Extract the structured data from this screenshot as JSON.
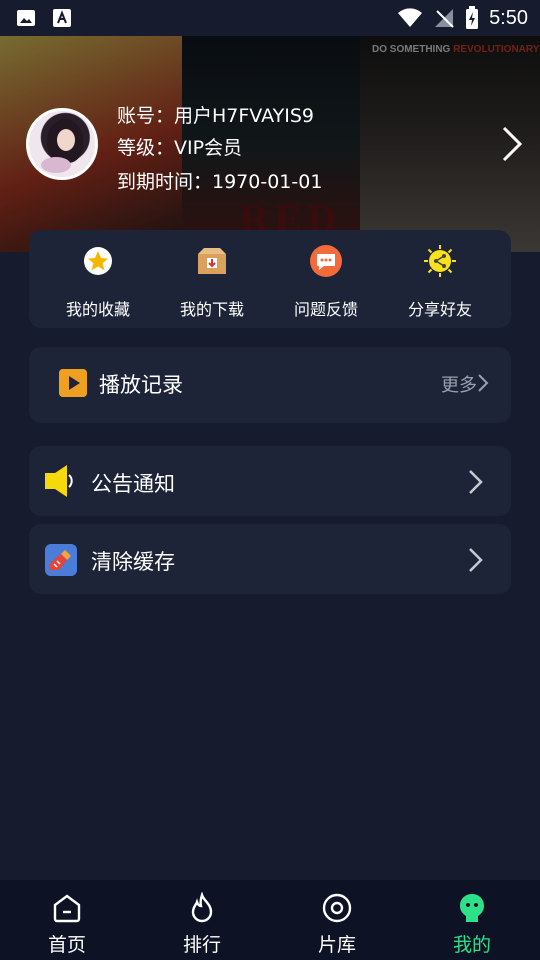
{
  "status_bar": {
    "time": "5:50"
  },
  "hero": {
    "poster_title_1": "RED",
    "poster_title_2_a": "DO SOMETHING ",
    "poster_title_2_b": "REVOLUTIONARY",
    "account_line": "账号：用户H7FVAYIS9",
    "level_line": "等级：VIP会员",
    "expire_line": "到期时间：1970-01-01"
  },
  "quick_actions": [
    {
      "label": "我的收藏",
      "icon": "star-icon"
    },
    {
      "label": "我的下载",
      "icon": "download-box-icon"
    },
    {
      "label": "问题反馈",
      "icon": "feedback-chat-icon"
    },
    {
      "label": "分享好友",
      "icon": "share-icon"
    }
  ],
  "history": {
    "label": "播放记录",
    "more": "更多"
  },
  "menu": {
    "notice": "公告通知",
    "cache": "清除缓存"
  },
  "tabs": [
    {
      "label": "首页",
      "icon": "home-icon"
    },
    {
      "label": "排行",
      "icon": "fire-icon"
    },
    {
      "label": "片库",
      "icon": "library-disc-icon"
    },
    {
      "label": "我的",
      "icon": "profile-face-icon",
      "active": true
    }
  ],
  "colors": {
    "accent": "#2de08a",
    "background": "#161b2e",
    "card": "#1e2438",
    "tabbar": "#0d1224"
  }
}
